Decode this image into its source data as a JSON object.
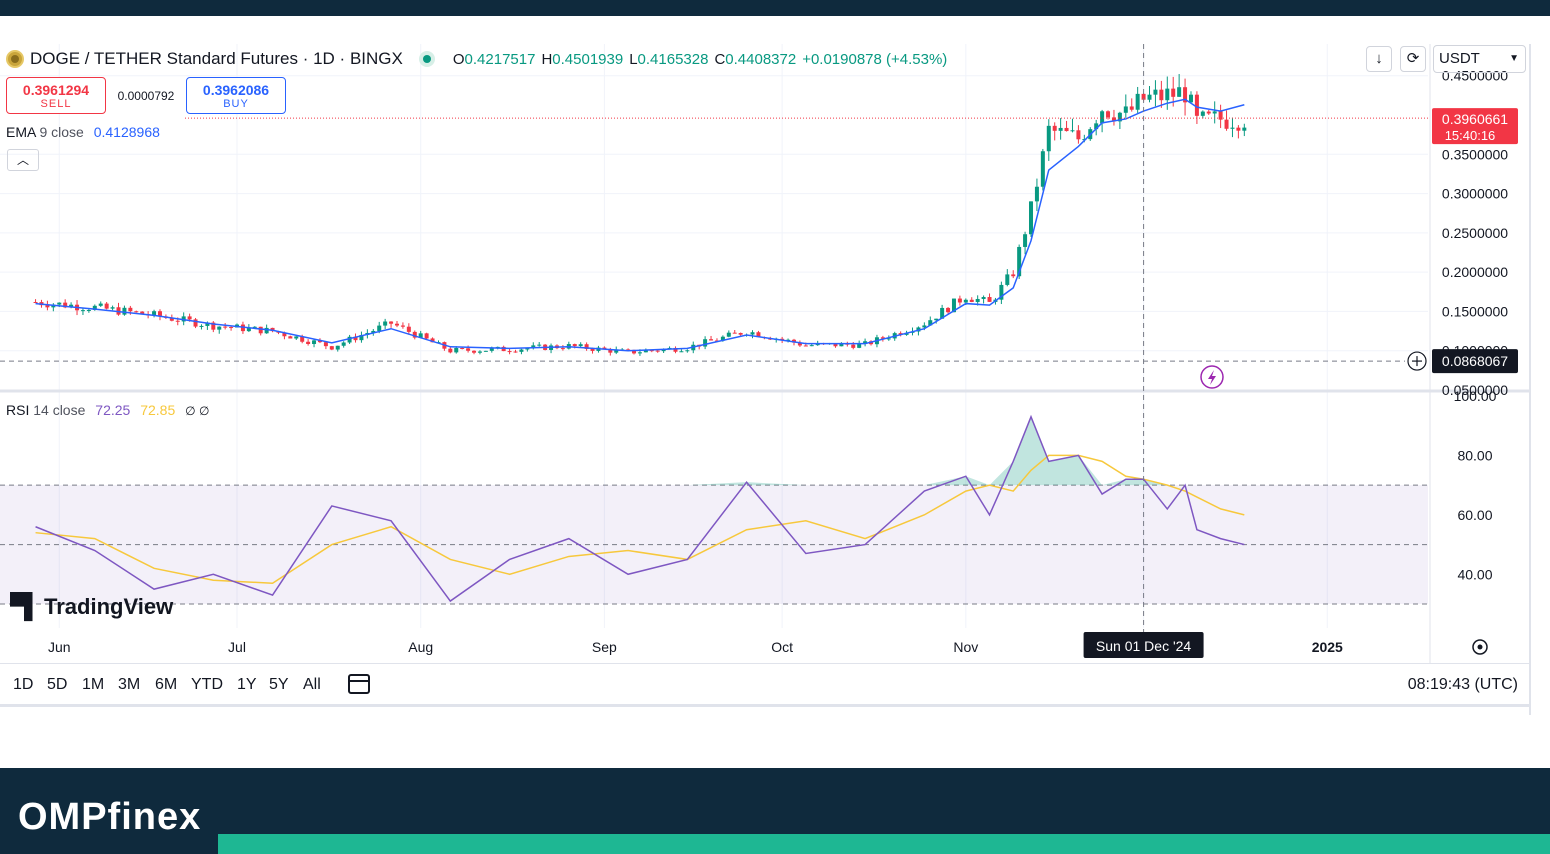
{
  "header": {
    "symbol": "DOGE / TETHER Standard Futures · 1D · BINGX",
    "o_label": "O",
    "o_value": "0.4217517",
    "h_label": "H",
    "h_value": "0.4501939",
    "l_label": "L",
    "l_value": "0.4165328",
    "c_label": "C",
    "c_value": "0.4408372",
    "change": "+0.0190878 (+4.53%)"
  },
  "trade": {
    "sell_price": "0.3961294",
    "sell_label": "SELL",
    "spread": "0.0000792",
    "buy_price": "0.3962086",
    "buy_label": "BUY"
  },
  "ema_legend": {
    "name": "EMA",
    "params": "9 close",
    "value": "0.4128968"
  },
  "rsi_legend": {
    "name": "RSI",
    "params": "14 close",
    "value": "72.25",
    "ma_value": "72.85",
    "icons": "∅ ∅"
  },
  "toolbar": {
    "currency": "USDT"
  },
  "price_axis": {
    "ticks": [
      "0.4500000",
      "0.3500000",
      "0.3000000",
      "0.2500000",
      "0.2000000",
      "0.1500000",
      "0.1000000",
      "0.0500000"
    ],
    "last_price": "0.3960661",
    "countdown": "15:40:16",
    "crosshair_price": "0.0868067"
  },
  "rsi_axis": {
    "ticks": [
      "100.00",
      "80.00",
      "60.00",
      "40.00"
    ]
  },
  "time_axis": {
    "labels": [
      "Jun",
      "Jul",
      "Aug",
      "Sep",
      "Oct",
      "Nov",
      "2025"
    ],
    "crosshair_date": "Sun 01 Dec '24"
  },
  "timeframes": [
    "1D",
    "5D",
    "1M",
    "3M",
    "6M",
    "YTD",
    "1Y",
    "5Y",
    "All"
  ],
  "clock": "08:19:43 (UTC)",
  "watermark": "TradingView",
  "brand": "OMPfinex",
  "colors": {
    "up": "#089981",
    "down": "#f23645",
    "ema": "#2962ff",
    "rsi": "#7e57c2",
    "rsi_ma": "#f7c83c",
    "band": "#0f2a3d",
    "accent": "#1eb793"
  },
  "chart_data": [
    {
      "type": "line",
      "title": "DOGE / TETHER Standard Futures · 1D · BINGX",
      "x": [
        "2024-05-28",
        "2024-06-07",
        "2024-06-17",
        "2024-06-27",
        "2024-07-07",
        "2024-07-17",
        "2024-07-27",
        "2024-08-06",
        "2024-08-16",
        "2024-08-26",
        "2024-09-05",
        "2024-09-15",
        "2024-09-25",
        "2024-10-05",
        "2024-10-15",
        "2024-10-25",
        "2024-11-01",
        "2024-11-05",
        "2024-11-09",
        "2024-11-12",
        "2024-11-15",
        "2024-11-20",
        "2024-11-24",
        "2024-11-28",
        "2024-12-01",
        "2024-12-05",
        "2024-12-08",
        "2024-12-10",
        "2024-12-14",
        "2024-12-18"
      ],
      "series": [
        {
          "name": "",
          "values": [
            0.162,
            0.155,
            0.145,
            0.132,
            0.125,
            0.105,
            0.135,
            0.1,
            0.102,
            0.106,
            0.098,
            0.104,
            0.125,
            0.107,
            0.108,
            0.135,
            0.17,
            0.16,
            0.2,
            0.28,
            0.38,
            0.37,
            0.41,
            0.4,
            0.42,
            0.425,
            0.43,
            0.39,
            0.395,
            0.396
          ]
        },
        {
          "name": "EMA 9 close",
          "values": [
            0.16,
            0.153,
            0.145,
            0.134,
            0.126,
            0.11,
            0.128,
            0.105,
            0.103,
            0.105,
            0.1,
            0.103,
            0.12,
            0.109,
            0.109,
            0.128,
            0.16,
            0.158,
            0.18,
            0.24,
            0.33,
            0.36,
            0.39,
            0.395,
            0.405,
            0.415,
            0.42,
            0.41,
            0.405,
            0.413
          ]
        }
      ],
      "ylim": [
        0.05,
        0.47
      ],
      "yticks": [
        0.45,
        0.35,
        0.3,
        0.25,
        0.2,
        0.15,
        0.1,
        0.05
      ]
    },
    {
      "type": "line",
      "title": "RSI 14 close",
      "x": [
        "2024-05-28",
        "2024-06-07",
        "2024-06-17",
        "2024-06-27",
        "2024-07-07",
        "2024-07-17",
        "2024-07-27",
        "2024-08-06",
        "2024-08-16",
        "2024-08-26",
        "2024-09-05",
        "2024-09-15",
        "2024-09-25",
        "2024-10-05",
        "2024-10-15",
        "2024-10-25",
        "2024-11-01",
        "2024-11-05",
        "2024-11-09",
        "2024-11-12",
        "2024-11-15",
        "2024-11-20",
        "2024-11-24",
        "2024-11-28",
        "2024-12-01",
        "2024-12-05",
        "2024-12-08",
        "2024-12-10",
        "2024-12-14",
        "2024-12-18"
      ],
      "series": [
        {
          "name": "RSI",
          "values": [
            56,
            48,
            35,
            40,
            33,
            63,
            58,
            31,
            45,
            52,
            40,
            45,
            71,
            47,
            50,
            68,
            73,
            60,
            78,
            93,
            78,
            80,
            67,
            72,
            72,
            62,
            70,
            55,
            52,
            50
          ]
        },
        {
          "name": "RSI MA",
          "values": [
            54,
            52,
            42,
            38,
            37,
            50,
            56,
            45,
            40,
            46,
            48,
            45,
            55,
            58,
            52,
            60,
            68,
            70,
            68,
            75,
            80,
            80,
            78,
            73,
            72,
            70,
            68,
            66,
            62,
            60
          ]
        }
      ],
      "ylim": [
        30,
        100
      ],
      "levels": [
        70,
        50,
        30
      ]
    }
  ]
}
